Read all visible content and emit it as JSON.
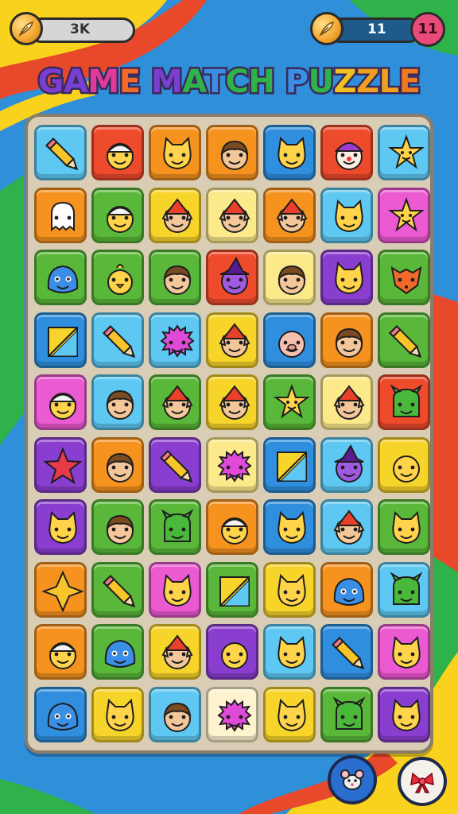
{
  "hud": {
    "left_value": "3K",
    "right_value": "11",
    "badge": "11",
    "coin_icon": "feather-coin-icon"
  },
  "title": {
    "text": "GAME MATCH PUZZLE",
    "colors": [
      "#7a3fd0",
      "#7a3fd0",
      "#e23a9a",
      "#f06a2a",
      "#7a3fd0",
      "#2fb24a",
      "#3a8ee6",
      "#2fb24a",
      "#2fb24a",
      "#3a8ee6",
      "#2fb24a",
      "#f0c020",
      "#f0a020",
      "#f0a020",
      "#f07a20",
      "#f07a20",
      "#f06a2a"
    ]
  },
  "palette": {
    "cyan": "#5ec8f2",
    "red": "#ee4a2c",
    "orange": "#f6931f",
    "yellow": "#f7d42a",
    "blue": "#2f8fde",
    "green": "#59b83a",
    "purple": "#8a3ed0",
    "pink": "#ec5ad2",
    "lightyellow": "#fbe98a",
    "cream": "#fdf3cf"
  },
  "board": {
    "rows": [
      [
        [
          "cyan",
          "pencil"
        ],
        [
          "red",
          "face-cap"
        ],
        [
          "orange",
          "cat"
        ],
        [
          "orange",
          "boy"
        ],
        [
          "blue",
          "cat"
        ],
        [
          "red",
          "clown"
        ],
        [
          "cyan",
          "star-face"
        ]
      ],
      [
        [
          "orange",
          "ghost"
        ],
        [
          "green",
          "face-cap"
        ],
        [
          "yellow",
          "elf"
        ],
        [
          "lightyellow",
          "elf"
        ],
        [
          "orange",
          "elf"
        ],
        [
          "cyan",
          "cat"
        ],
        [
          "pink",
          "star-face"
        ]
      ],
      [
        [
          "green",
          "blob"
        ],
        [
          "green",
          "chick"
        ],
        [
          "green",
          "boy"
        ],
        [
          "red",
          "witch"
        ],
        [
          "lightyellow",
          "boy"
        ],
        [
          "purple",
          "cat"
        ],
        [
          "green",
          "fox"
        ]
      ],
      [
        [
          "blue",
          "square"
        ],
        [
          "cyan",
          "pencil"
        ],
        [
          "cyan",
          "furball"
        ],
        [
          "yellow",
          "elf"
        ],
        [
          "blue",
          "pig"
        ],
        [
          "orange",
          "boy"
        ],
        [
          "green",
          "pencil"
        ]
      ],
      [
        [
          "pink",
          "face-cap"
        ],
        [
          "cyan",
          "boy"
        ],
        [
          "green",
          "elf"
        ],
        [
          "yellow",
          "elf"
        ],
        [
          "green",
          "star-face"
        ],
        [
          "lightyellow",
          "elf"
        ],
        [
          "red",
          "monster"
        ]
      ],
      [
        [
          "purple",
          "star"
        ],
        [
          "orange",
          "boy"
        ],
        [
          "purple",
          "pencil"
        ],
        [
          "lightyellow",
          "furball"
        ],
        [
          "blue",
          "square"
        ],
        [
          "cyan",
          "witch"
        ],
        [
          "yellow",
          "smiley"
        ]
      ],
      [
        [
          "purple",
          "cat"
        ],
        [
          "green",
          "boy"
        ],
        [
          "green",
          "monster"
        ],
        [
          "orange",
          "face-cap"
        ],
        [
          "blue",
          "cat"
        ],
        [
          "cyan",
          "elf"
        ],
        [
          "green",
          "cat"
        ]
      ],
      [
        [
          "orange",
          "diamond"
        ],
        [
          "green",
          "pencil"
        ],
        [
          "pink",
          "cat"
        ],
        [
          "green",
          "square"
        ],
        [
          "yellow",
          "cat"
        ],
        [
          "orange",
          "blob"
        ],
        [
          "cyan",
          "monster"
        ]
      ],
      [
        [
          "orange",
          "face-cap"
        ],
        [
          "green",
          "blob"
        ],
        [
          "yellow",
          "elf"
        ],
        [
          "purple",
          "smiley"
        ],
        [
          "cyan",
          "cat"
        ],
        [
          "blue",
          "pencil"
        ],
        [
          "pink",
          "cat"
        ]
      ],
      [
        [
          "blue",
          "blob"
        ],
        [
          "yellow",
          "cat"
        ],
        [
          "cyan",
          "boy"
        ],
        [
          "cream",
          "furball"
        ],
        [
          "yellow",
          "cat"
        ],
        [
          "green",
          "monster"
        ],
        [
          "purple",
          "cat"
        ]
      ]
    ]
  },
  "buttons": {
    "mouse_icon": "mouse-icon",
    "bow_icon": "gift-bow-icon"
  }
}
